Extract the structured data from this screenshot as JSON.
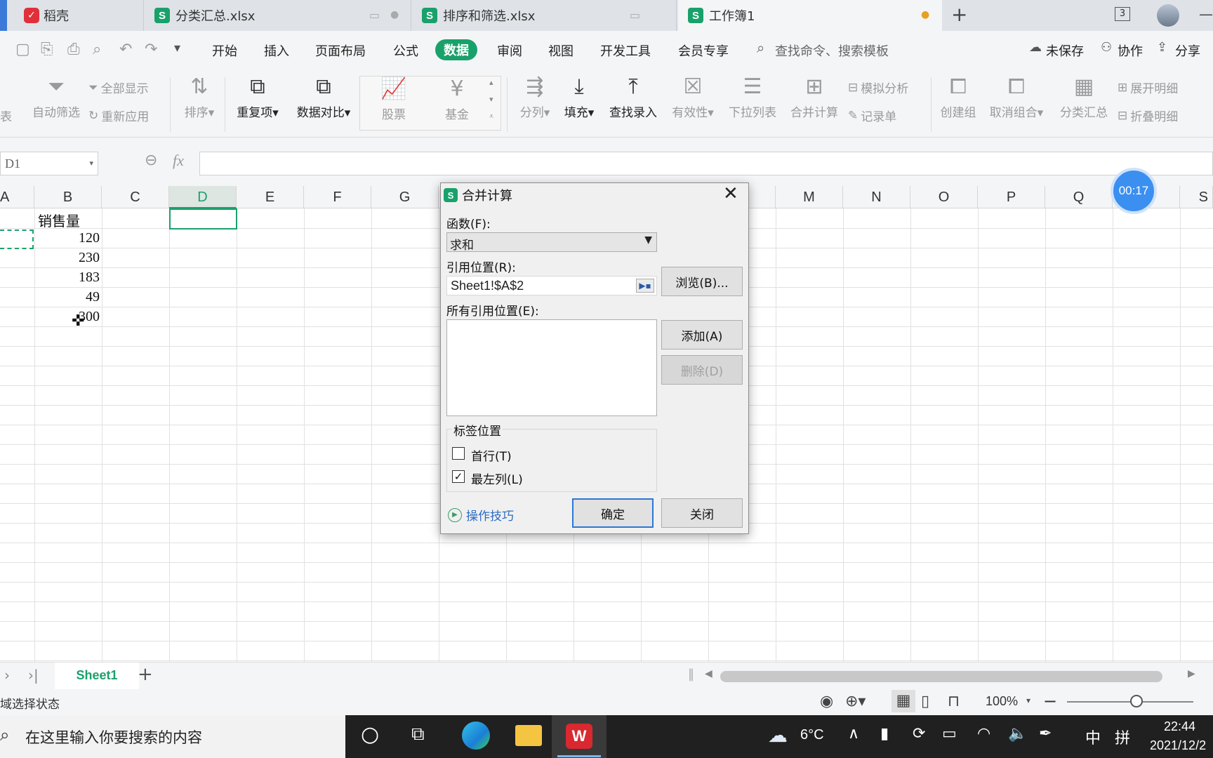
{
  "tabs": [
    {
      "label": "稻壳"
    },
    {
      "label": "分类汇总.xlsx"
    },
    {
      "label": "排序和筛选.xlsx"
    },
    {
      "label": "工作簿1"
    }
  ],
  "tabbar": {
    "new_tab": "+",
    "window_count": "3"
  },
  "menu": {
    "items": [
      "开始",
      "插入",
      "页面布局",
      "公式",
      "数据",
      "审阅",
      "视图",
      "开发工具",
      "会员专享"
    ],
    "active": "数据",
    "search_placeholder": "查找命令、搜索模板",
    "unsaved": "未保存",
    "collab": "协作",
    "share": "分享"
  },
  "ribbon": {
    "left_cut": "表",
    "auto_filter": "自动筛选",
    "show_all": "全部显示",
    "reapply": "重新应用",
    "sort": "排序",
    "duplicates": "重复项",
    "compare": "数据对比",
    "stock": "股票",
    "fund": "基金",
    "split": "分列",
    "fill": "填充",
    "lookup": "查找录入",
    "validity": "有效性",
    "dropdown": "下拉列表",
    "consolidate": "合并计算",
    "simulate": "模拟分析",
    "record": "记录单",
    "create_group": "创建组",
    "ungroup": "取消组合",
    "subtotal": "分类汇总",
    "expand": "展开明细",
    "collapse": "折叠明细"
  },
  "formula": {
    "namebox": "D1",
    "fx": "fx"
  },
  "columns": [
    "A",
    "B",
    "C",
    "D",
    "E",
    "F",
    "G",
    "M",
    "N",
    "O",
    "P",
    "Q",
    "S"
  ],
  "cells": {
    "b1": "销售量",
    "b2": "120",
    "b3": "230",
    "b4": "183",
    "b5": "49",
    "b6": "300"
  },
  "timer": "00:17",
  "dialog": {
    "title": "合并计算",
    "function_label": "函数(F):",
    "function_value": "求和",
    "ref_label": "引用位置(R):",
    "ref_value": "Sheet1!$A$2",
    "browse": "浏览(B)...",
    "all_refs_label": "所有引用位置(E):",
    "add": "添加(A)",
    "delete": "删除(D)",
    "label_group": "标签位置",
    "first_row": "首行(T)",
    "first_row_checked": false,
    "left_col": "最左列(L)",
    "left_col_checked": true,
    "tips": "操作技巧",
    "ok": "确定",
    "close": "关闭"
  },
  "sheets": {
    "active": "Sheet1",
    "add": "+"
  },
  "status": {
    "text": "域选择状态",
    "zoom": "100%"
  },
  "taskbar": {
    "search_placeholder": "在这里输入你要搜索的内容",
    "weather": "6°C",
    "ime": "中",
    "time": "22:44",
    "date": "2021/12/2"
  },
  "colors": {
    "accent": "#1aa16b",
    "timer": "#3b8ff0",
    "taskbar": "#202020"
  }
}
